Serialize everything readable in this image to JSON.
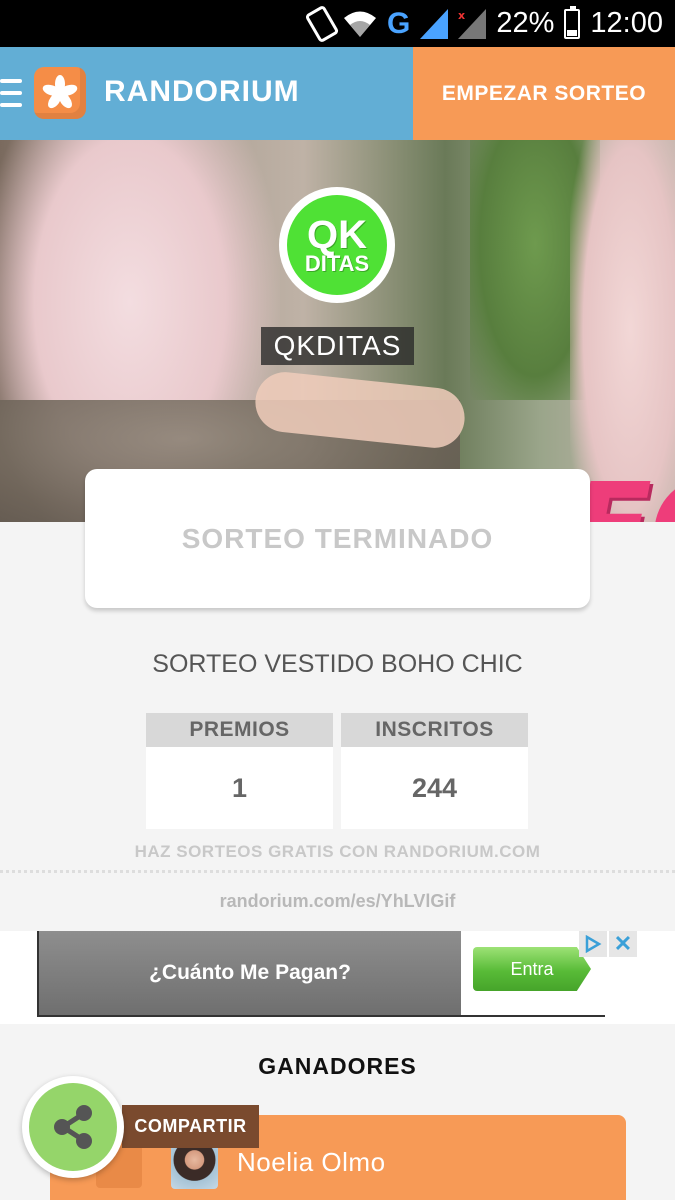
{
  "status_bar": {
    "battery": "22%",
    "time": "12:00",
    "network": "G",
    "icons": [
      "rotate-phone-icon",
      "wifi-icon",
      "cell-signal-icon",
      "cell-signal-icon",
      "battery-icon"
    ]
  },
  "app_bar": {
    "brand": "RANDORIUM",
    "start_button": "EMPEZAR SORTEO",
    "colors": {
      "bar": "#62aed5",
      "start": "#f79a56"
    }
  },
  "hero": {
    "banner_text": "SORTEO!!",
    "avatar_line1": "QK",
    "avatar_line2": "DITAS",
    "organizer": "QKDITAS"
  },
  "raffle": {
    "status": "SORTEO TERMINADO",
    "title": "SORTEO VESTIDO BOHO CHIC",
    "stats": [
      {
        "label": "PREMIOS",
        "value": "1"
      },
      {
        "label": "INSCRITOS",
        "value": "244"
      }
    ],
    "promo": "HAZ SORTEOS GRATIS CON RANDORIUM.COM",
    "short_link": "randorium.com/es/YhLVlGif"
  },
  "ad": {
    "headline": "¿Cuánto Me Pagan?",
    "cta": "Entra",
    "close": "✕"
  },
  "winners": {
    "title": "GANADORES",
    "items": [
      {
        "name": "Noelia Olmo"
      }
    ]
  },
  "share": {
    "label": "COMPARTIR"
  }
}
